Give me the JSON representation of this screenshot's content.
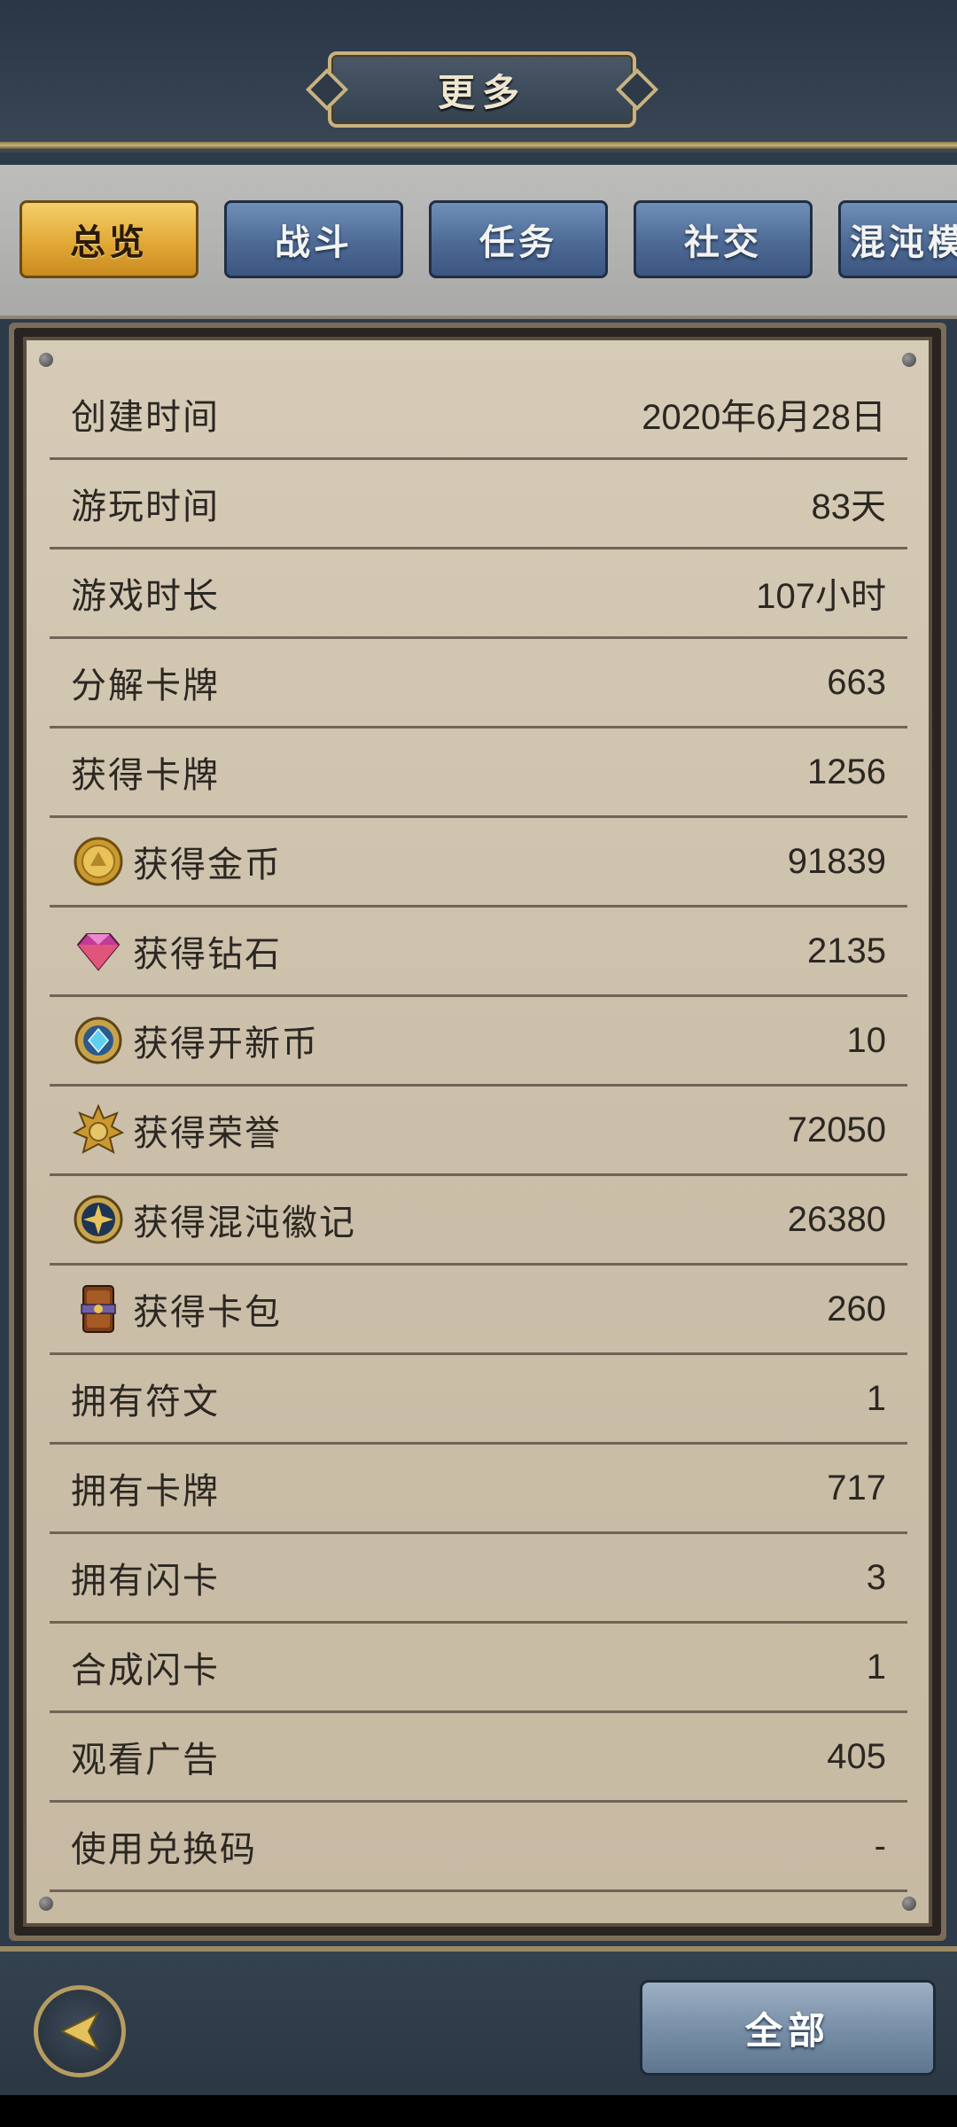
{
  "header": {
    "title": "更多"
  },
  "tabs": [
    {
      "label": "总览",
      "active": true
    },
    {
      "label": "战斗",
      "active": false
    },
    {
      "label": "任务",
      "active": false
    },
    {
      "label": "社交",
      "active": false
    },
    {
      "label": "混沌模",
      "active": false
    }
  ],
  "stats": [
    {
      "label": "创建时间",
      "value": "2020年6月28日"
    },
    {
      "label": "游玩时间",
      "value": "83天"
    },
    {
      "label": "游戏时长",
      "value": "107小时"
    },
    {
      "label": "分解卡牌",
      "value": "663"
    },
    {
      "label": "获得卡牌",
      "value": "1256"
    },
    {
      "label": "获得金币",
      "value": "91839",
      "icon": "gold-coin-icon"
    },
    {
      "label": "获得钻石",
      "value": "2135",
      "icon": "diamond-icon"
    },
    {
      "label": "获得开新币",
      "value": "10",
      "icon": "new-coin-icon"
    },
    {
      "label": "获得荣誉",
      "value": "72050",
      "icon": "honor-badge-icon"
    },
    {
      "label": "获得混沌徽记",
      "value": "26380",
      "icon": "chaos-emblem-icon"
    },
    {
      "label": "获得卡包",
      "value": "260",
      "icon": "card-pack-icon"
    },
    {
      "label": "拥有符文",
      "value": "1"
    },
    {
      "label": "拥有卡牌",
      "value": "717"
    },
    {
      "label": "拥有闪卡",
      "value": "3"
    },
    {
      "label": "合成闪卡",
      "value": "1"
    },
    {
      "label": "观看广告",
      "value": "405"
    },
    {
      "label": "使用兑换码",
      "value": "-"
    }
  ],
  "footer": {
    "all_label": "全部"
  },
  "colors": {
    "active_tab": "#e2a936",
    "inactive_tab": "#4d6a95",
    "panel_bg": "#cbbfa9",
    "text": "#2b2722"
  }
}
